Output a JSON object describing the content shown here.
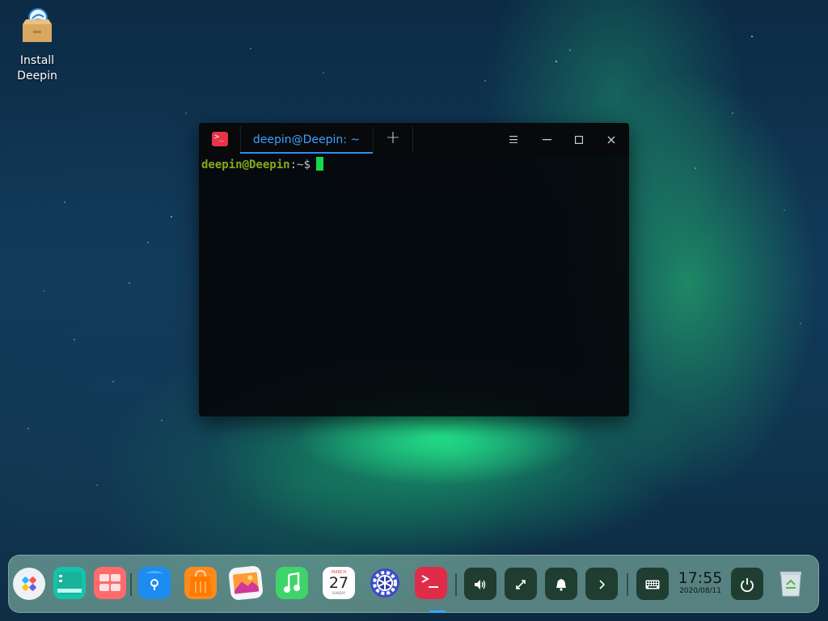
{
  "desktop": {
    "install_icon": {
      "label": "Install Deepin",
      "icon": "installer-box-icon"
    }
  },
  "terminal": {
    "tab_title": "deepin@Deepin: ~",
    "new_tab_icon": "plus-icon",
    "menu_icon": "hamburger-menu-icon",
    "minimize_icon": "minimize-icon",
    "maximize_icon": "maximize-icon",
    "close_icon": "close-icon",
    "prompt_user": "deepin@Deepin",
    "prompt_path": ":~",
    "prompt_symbol": "$",
    "cursor_color": "#18d84a"
  },
  "dock": {
    "apps": [
      {
        "name": "launcher",
        "icon": "launcher-icon"
      },
      {
        "name": "multitasking-view",
        "icon": "multitask-icon"
      },
      {
        "name": "show-desktop",
        "icon": "show-desktop-icon"
      },
      {
        "name": "file-manager",
        "icon": "file-manager-icon"
      },
      {
        "name": "app-store",
        "icon": "app-store-icon"
      },
      {
        "name": "image-viewer",
        "icon": "image-viewer-icon"
      },
      {
        "name": "music",
        "icon": "music-icon"
      },
      {
        "name": "calendar",
        "icon": "calendar-icon",
        "month": "MARCH",
        "day": "27",
        "weekday": "SUNDAY"
      },
      {
        "name": "control-center",
        "icon": "settings-gear-icon"
      },
      {
        "name": "terminal",
        "icon": "terminal-icon",
        "active": true
      }
    ],
    "tray": [
      {
        "name": "volume",
        "icon": "volume-icon"
      },
      {
        "name": "network",
        "icon": "network-icon"
      },
      {
        "name": "notifications",
        "icon": "bell-icon"
      },
      {
        "name": "expand",
        "icon": "chevron-right-icon"
      },
      {
        "name": "keyboard",
        "icon": "keyboard-icon"
      }
    ],
    "clock": {
      "time": "17:55",
      "date": "2020/08/11"
    },
    "power_icon": "power-icon",
    "trash_icon": "trash-icon"
  },
  "colors": {
    "tab_text": "#3ea2ff",
    "prompt_user": "#86a91c",
    "prompt_path": "#3a8ee6",
    "terminal_icon_bg": "#e8334a"
  }
}
